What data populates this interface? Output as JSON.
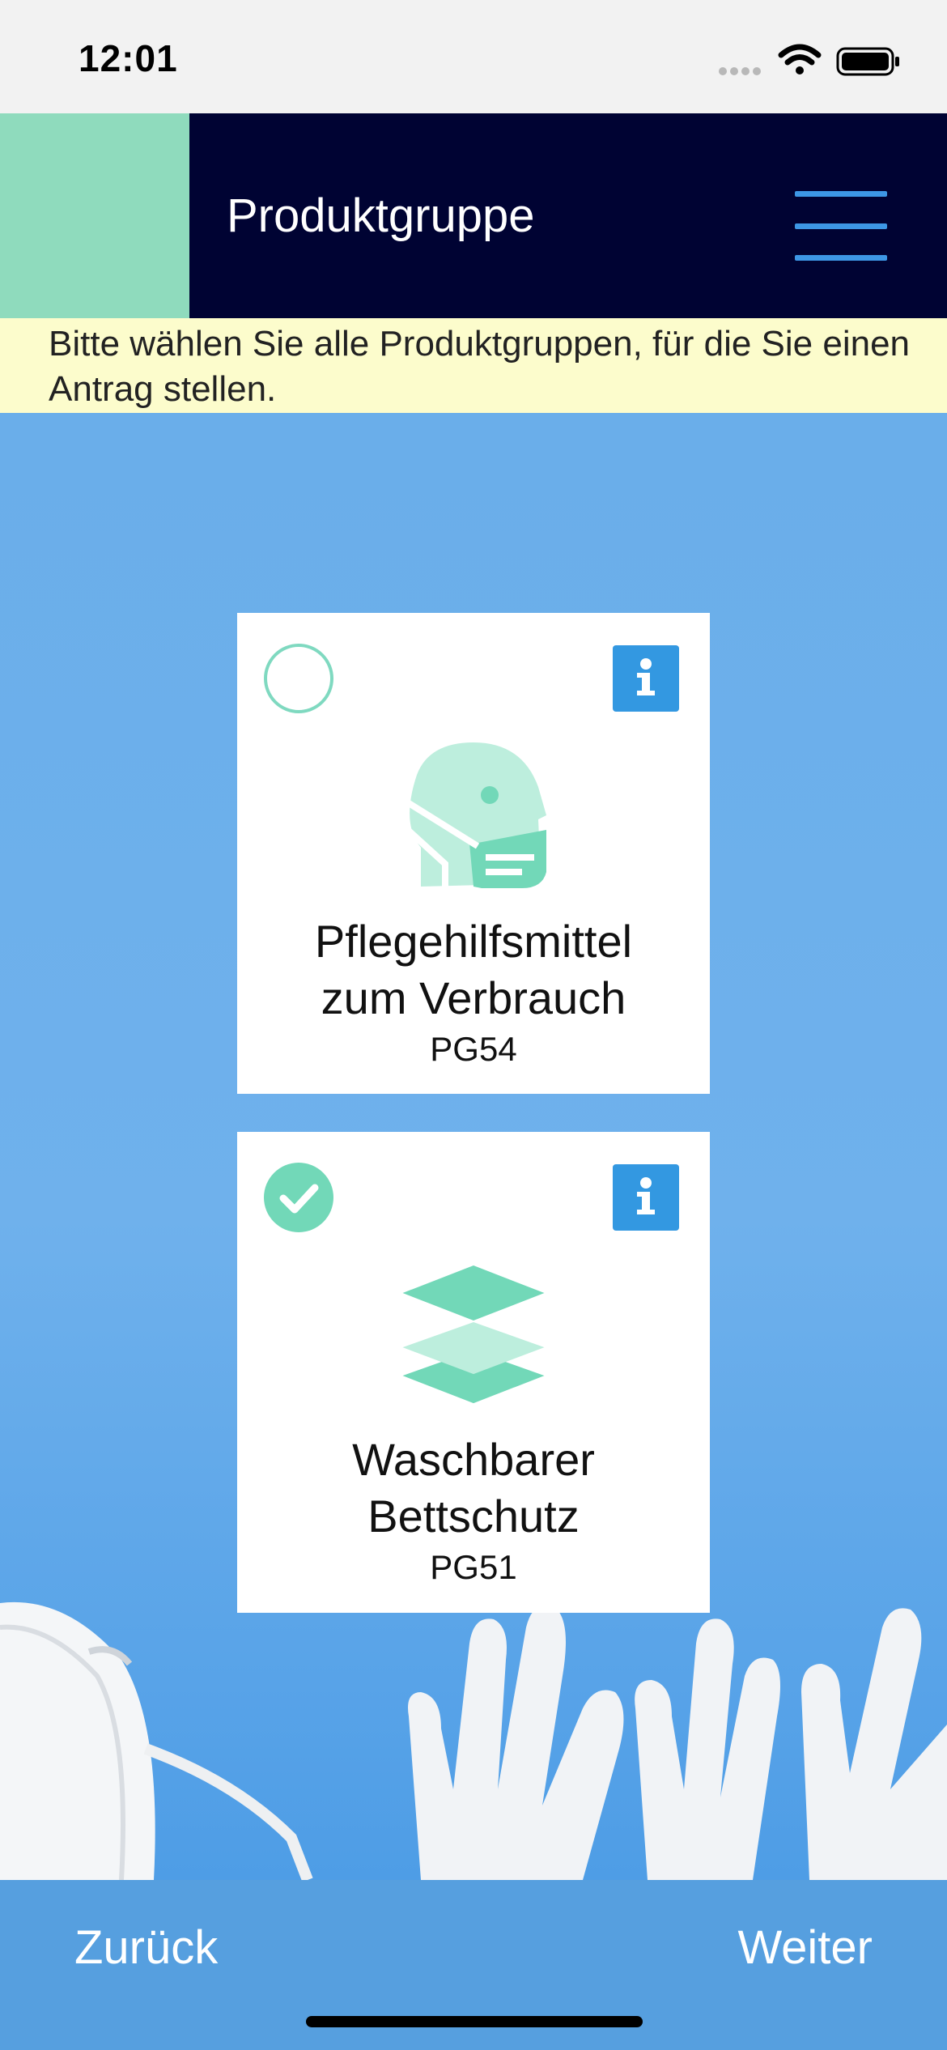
{
  "status_bar": {
    "time": "12:01"
  },
  "header": {
    "title": "Produktgruppe"
  },
  "notice": {
    "text": "Bitte wählen Sie alle Produktgruppen, für die Sie einen Antrag stellen."
  },
  "cards": [
    {
      "title_line1": "Pflegehilfsmittel",
      "title_line2": "zum Verbrauch",
      "code": "PG54",
      "selected": false,
      "icon": "face-mask-icon"
    },
    {
      "title_line1": "Waschbarer",
      "title_line2": "Bettschutz",
      "code": "PG51",
      "selected": true,
      "icon": "layers-icon"
    }
  ],
  "footer": {
    "back_label": "Zurück",
    "next_label": "Weiter"
  },
  "colors": {
    "header_bg": "#000333",
    "accent_green": "#8fdbbd",
    "notice_bg": "#fcfccc",
    "page_bg": "#6aaeea",
    "info_blue": "#3398e1",
    "footer_bg": "#569fdf"
  }
}
